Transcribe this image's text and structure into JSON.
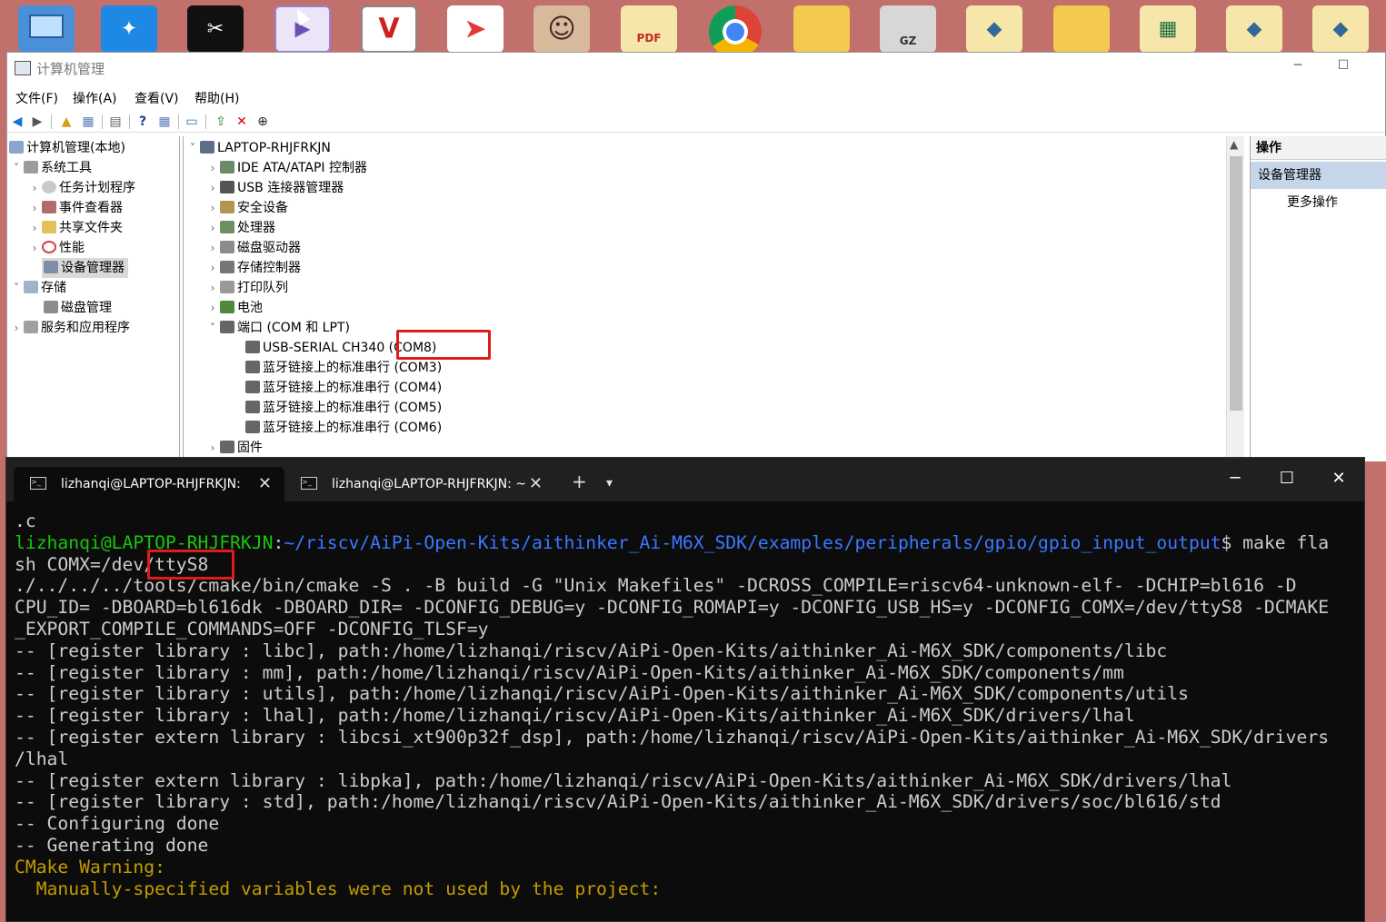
{
  "desktop": {
    "icons": [
      {
        "name": "computer-icon",
        "color": "#4a90d9",
        "glyph": ""
      },
      {
        "name": "bird-app-icon",
        "color": "#1e88e5",
        "glyph": "✦"
      },
      {
        "name": "capcut-icon",
        "color": "#111111",
        "glyph": "✂"
      },
      {
        "name": "media-app-icon",
        "color": "#9b7fcf",
        "glyph": "▶"
      },
      {
        "name": "vnc-icon",
        "color": "#cc2222",
        "glyph": "V"
      },
      {
        "name": "send-app-icon",
        "color": "#e53935",
        "glyph": "➤"
      },
      {
        "name": "portrait-app-icon",
        "color": "#6d4c41",
        "glyph": "☺"
      },
      {
        "name": "pdf-file-icon",
        "color": "#f0d27a",
        "glyph": ""
      },
      {
        "name": "chrome-icon",
        "color": "#dd4b39",
        "glyph": ""
      },
      {
        "name": "folder-icon",
        "color": "#f3c94f",
        "glyph": ""
      },
      {
        "name": "gz-archive-icon",
        "color": "#9e9e9e",
        "glyph": ""
      },
      {
        "name": "python-file-icon",
        "color": "#f0d27a",
        "glyph": ""
      },
      {
        "name": "folder-icon-2",
        "color": "#f3c94f",
        "glyph": ""
      },
      {
        "name": "excel-file-icon",
        "color": "#f0d27a",
        "glyph": ""
      },
      {
        "name": "python-file-icon-2",
        "color": "#f0d27a",
        "glyph": ""
      },
      {
        "name": "python-file-icon-3",
        "color": "#f0d27a",
        "glyph": ""
      }
    ]
  },
  "mmc": {
    "title": "计算机管理",
    "menu": [
      "文件(F)",
      "操作(A)",
      "查看(V)",
      "帮助(H)"
    ],
    "left_tree": [
      {
        "label": "计算机管理(本地)"
      },
      {
        "label": "系统工具"
      },
      {
        "label": "任务计划程序"
      },
      {
        "label": "事件查看器"
      },
      {
        "label": "共享文件夹"
      },
      {
        "label": "性能"
      },
      {
        "label": "设备管理器"
      },
      {
        "label": "存储"
      },
      {
        "label": "磁盘管理"
      },
      {
        "label": "服务和应用程序"
      }
    ],
    "device_tree": [
      {
        "label": "LAPTOP-RHJFRKJN"
      },
      {
        "label": "IDE ATA/ATAPI 控制器"
      },
      {
        "label": "USB 连接器管理器"
      },
      {
        "label": "安全设备"
      },
      {
        "label": "处理器"
      },
      {
        "label": "磁盘驱动器"
      },
      {
        "label": "存储控制器"
      },
      {
        "label": "打印队列"
      },
      {
        "label": "电池"
      },
      {
        "label": "端口 (COM 和 LPT)"
      },
      {
        "label": "USB-SERIAL CH340 (COM8)"
      },
      {
        "label": "蓝牙链接上的标准串行 (COM3)"
      },
      {
        "label": "蓝牙链接上的标准串行 (COM4)"
      },
      {
        "label": "蓝牙链接上的标准串行 (COM5)"
      },
      {
        "label": "蓝牙链接上的标准串行 (COM6)"
      },
      {
        "label": "固件"
      }
    ],
    "actions": {
      "header": "操作",
      "selected": "设备管理器",
      "more": "更多操作"
    }
  },
  "terminal": {
    "tabs": [
      "lizhanqi@LAPTOP-RHJFRKJN:",
      "lizhanqi@LAPTOP-RHJFRKJN: ~"
    ],
    "lines": {
      "l0": ".c",
      "prompt_user": "lizhanqi@LAPTOP-RHJFRKJN",
      "prompt_sep": ":",
      "prompt_path": "~/riscv/AiPi-Open-Kits/aithinker_Ai-M6X_SDK/examples/peripherals/gpio/gpio_input_output",
      "prompt_cmd": "$ make fla",
      "l2": "sh COMX=/dev/ttyS8",
      "l3": "./../../../tools/cmake/bin/cmake -S . -B build -G \"Unix Makefiles\" -DCROSS_COMPILE=riscv64-unknown-elf- -DCHIP=bl616 -D",
      "l4": "CPU_ID= -DBOARD=bl616dk -DBOARD_DIR= -DCONFIG_DEBUG=y -DCONFIG_ROMAPI=y -DCONFIG_USB_HS=y -DCONFIG_COMX=/dev/ttyS8 -DCMAKE",
      "l5": "_EXPORT_COMPILE_COMMANDS=OFF -DCONFIG_TLSF=y",
      "l6": "-- [register library : libc], path:/home/lizhanqi/riscv/AiPi-Open-Kits/aithinker_Ai-M6X_SDK/components/libc",
      "l7": "-- [register library : mm], path:/home/lizhanqi/riscv/AiPi-Open-Kits/aithinker_Ai-M6X_SDK/components/mm",
      "l8": "-- [register library : utils], path:/home/lizhanqi/riscv/AiPi-Open-Kits/aithinker_Ai-M6X_SDK/components/utils",
      "l9": "-- [register library : lhal], path:/home/lizhanqi/riscv/AiPi-Open-Kits/aithinker_Ai-M6X_SDK/drivers/lhal",
      "l10": "-- [register extern library : libcsi_xt900p32f_dsp], path:/home/lizhanqi/riscv/AiPi-Open-Kits/aithinker_Ai-M6X_SDK/drivers",
      "l11": "/lhal",
      "l12": "-- [register extern library : libpka], path:/home/lizhanqi/riscv/AiPi-Open-Kits/aithinker_Ai-M6X_SDK/drivers/lhal",
      "l13": "-- [register library : std], path:/home/lizhanqi/riscv/AiPi-Open-Kits/aithinker_Ai-M6X_SDK/drivers/soc/bl616/std",
      "l14": "-- Configuring done",
      "l15": "-- Generating done",
      "l16": "CMake Warning:",
      "l17": "  Manually-specified variables were not used by the project:"
    }
  },
  "colors": {
    "desktop_bg": "#c2706b",
    "highlight_red": "#e01b1b",
    "terminal_green": "#16c60c",
    "terminal_blue": "#3b78ff",
    "terminal_yellow": "#c19c00",
    "action_selected_bg": "#c5d6ea"
  }
}
